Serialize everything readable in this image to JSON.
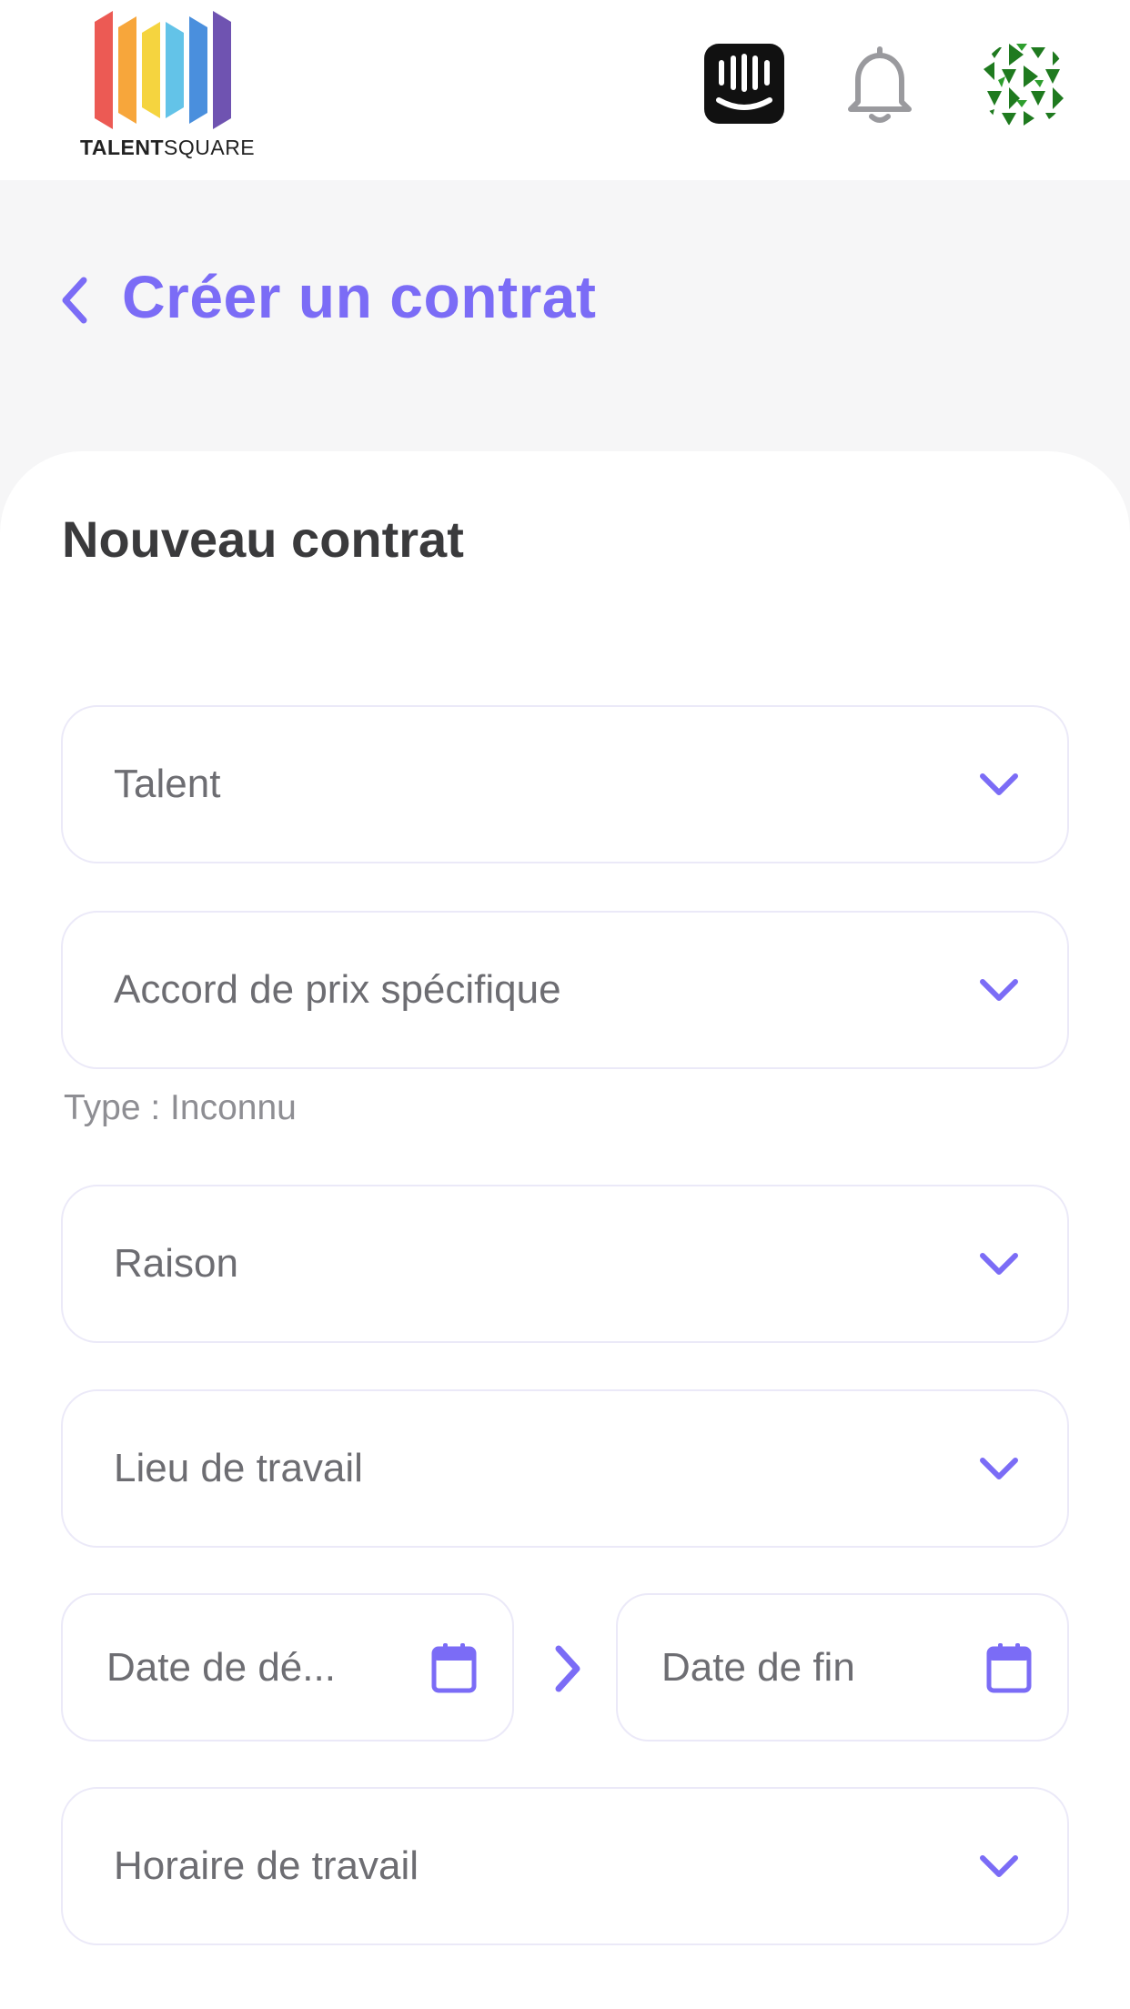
{
  "header": {
    "logo_bold": "TALENT",
    "logo_light": "SQUARE",
    "icons": [
      "intercom-icon",
      "bell-icon",
      "avatar"
    ]
  },
  "page": {
    "title": "Créer un contrat"
  },
  "form": {
    "title": "Nouveau contrat",
    "talent": {
      "placeholder": "Talent"
    },
    "price_agreement": {
      "placeholder": "Accord de prix spécifique",
      "hint": "Type : Inconnu"
    },
    "reason": {
      "placeholder": "Raison"
    },
    "workplace": {
      "placeholder": "Lieu de travail"
    },
    "start_date": {
      "placeholder": "Date de dé..."
    },
    "end_date": {
      "placeholder": "Date de fin"
    },
    "schedule": {
      "placeholder": "Horaire de travail"
    }
  },
  "colors": {
    "accent": "#7b6cf6",
    "logo_bars": [
      "#ec5a54",
      "#f7a63b",
      "#f5d43f",
      "#63c3e8",
      "#4a8fdd",
      "#6f53b1"
    ]
  }
}
